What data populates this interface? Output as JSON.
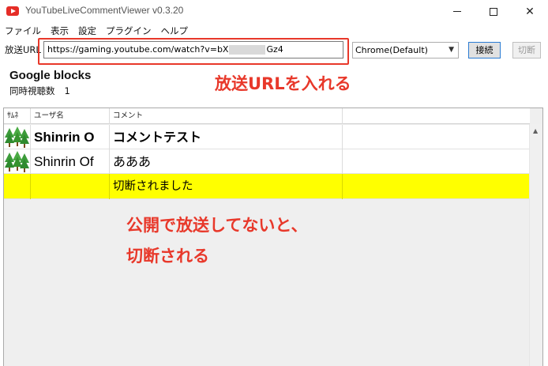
{
  "window": {
    "title": "YouTubeLiveCommentViewer v0.3.20",
    "icon": "youtube-icon"
  },
  "menu": [
    "ファイル",
    "表示",
    "設定",
    "プラグイン",
    "ヘルプ"
  ],
  "url_bar": {
    "label": "放送URL",
    "value_prefix": "https://gaming.youtube.com/watch?v=bX",
    "value_suffix": "Gz4",
    "browser": "Chrome(Default)",
    "connect_label": "接続",
    "disconnect_label": "切断"
  },
  "stream": {
    "title": "Google blocks",
    "viewers_label": "同時視聴数",
    "viewers": "1"
  },
  "grid": {
    "headers": {
      "thumb": "ｻﾑﾈ",
      "name": "ユーザ名",
      "comment": "コメント"
    },
    "rows": [
      {
        "name": "Shinrin O",
        "comment": "コメントテスト"
      },
      {
        "name": "Shinrin Of",
        "comment": "あああ"
      },
      {
        "name": "",
        "comment": "切断されました"
      }
    ]
  },
  "annotations": {
    "url_hint": "放送URLを入れる",
    "warning_line1": "公開で放送してないと、",
    "warning_line2": "切断される"
  },
  "colors": {
    "annotation": "#e8382a",
    "system_row": "#ffff00",
    "connect_border": "#2b7cd3"
  }
}
